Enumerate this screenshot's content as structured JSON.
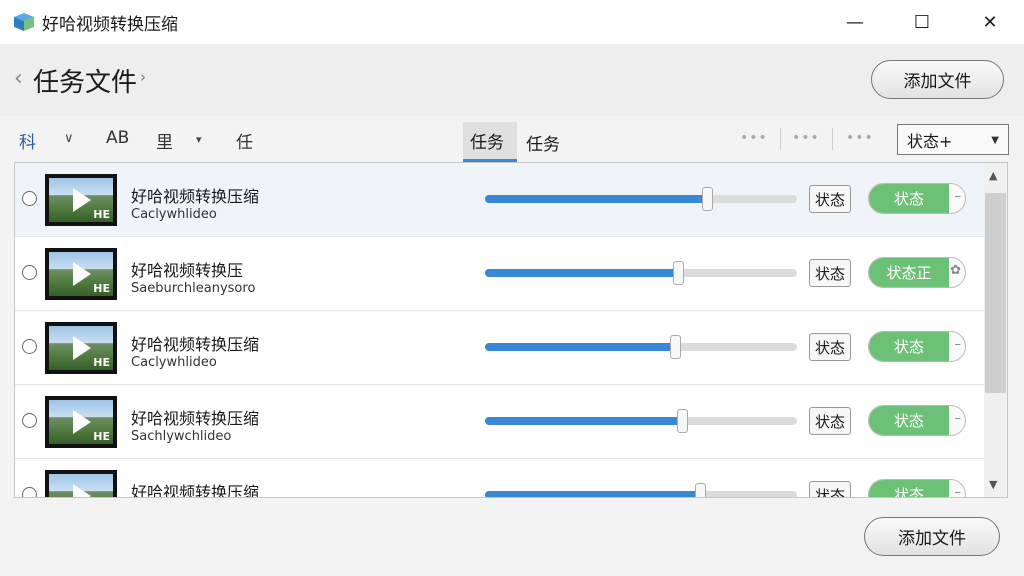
{
  "window": {
    "title": "好哈视频转换压缩",
    "min_icon": "—",
    "max_icon": "☐",
    "close_icon": "✕"
  },
  "header": {
    "back_icon": "‹",
    "title": "任务文件",
    "next_icon": "›",
    "add_button": "添加文件"
  },
  "toolbar": {
    "sort_label": "科",
    "chevron1": "∨",
    "ab_label": "AB",
    "group_label": "里",
    "chevron2": "▾",
    "task_label": "任",
    "tabs": [
      {
        "label": "任务"
      },
      {
        "label": "任务"
      }
    ],
    "dots": "•••",
    "status_select": {
      "value": "状态+",
      "chevron": "▼"
    }
  },
  "items": [
    {
      "title": "好哈视频转换压缩",
      "subtitle": "Caclywhlideo",
      "badge": "HE",
      "progress": 0.71,
      "state": "状态",
      "action": "状态",
      "action_end": "–"
    },
    {
      "title": "好哈视频转换压",
      "subtitle": "Saeburchleanysoro",
      "badge": "HE",
      "progress": 0.62,
      "state": "状态",
      "action": "状态正",
      "action_end": "✿"
    },
    {
      "title": "好哈视频转换压缩",
      "subtitle": "Caclywhlideo",
      "badge": "HE",
      "progress": 0.61,
      "state": "状态",
      "action": "状态",
      "action_end": "–"
    },
    {
      "title": "好哈视频转换压缩",
      "subtitle": "Sachlywchlideo",
      "badge": "HE",
      "progress": 0.63,
      "state": "状态",
      "action": "状态",
      "action_end": "–"
    },
    {
      "title": "好哈视频转换压缩",
      "subtitle": "",
      "badge": "",
      "progress": 0.69,
      "state": "状态",
      "action": "状态",
      "action_end": "–"
    }
  ],
  "scrollbar": {
    "up_icon": "▲",
    "down_icon": "▼"
  },
  "footer": {
    "add_button": "添加文件"
  },
  "colors": {
    "accent": "#3a87d7",
    "green": "#6cc177"
  }
}
